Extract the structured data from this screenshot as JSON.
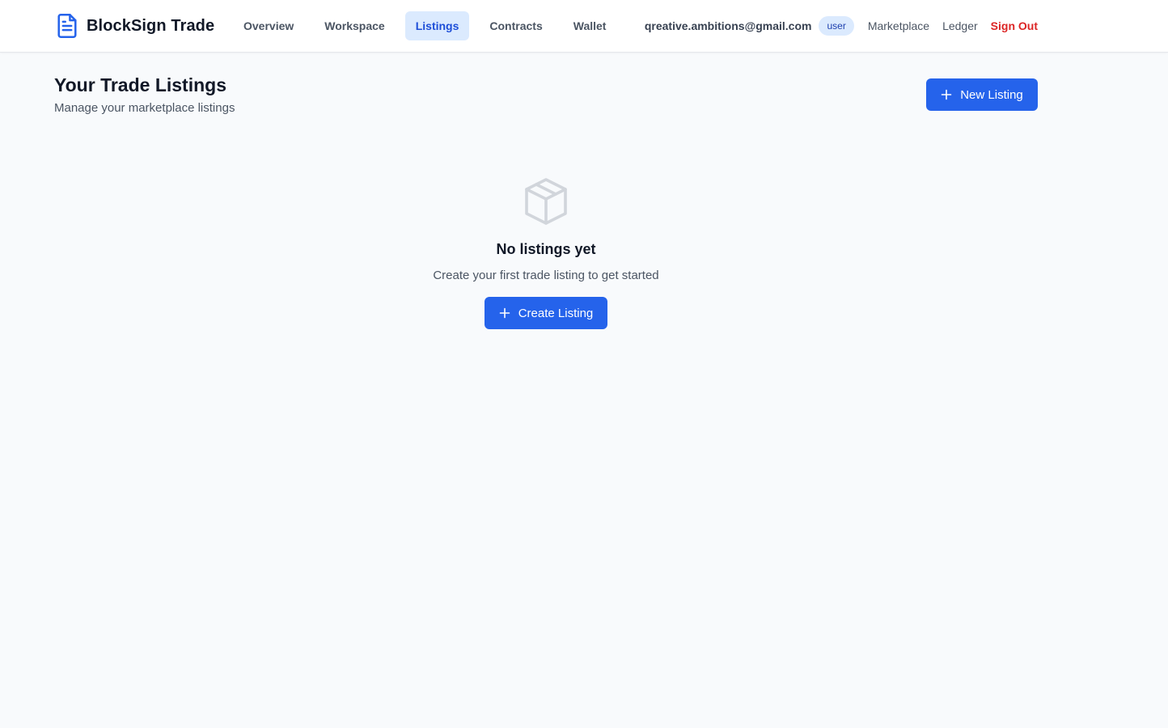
{
  "brand": {
    "name": "BlockSign Trade",
    "icon": "document-icon",
    "color": "#2563eb"
  },
  "nav": {
    "items": [
      {
        "label": "Overview",
        "active": false
      },
      {
        "label": "Workspace",
        "active": false
      },
      {
        "label": "Listings",
        "active": true
      },
      {
        "label": "Contracts",
        "active": false
      },
      {
        "label": "Wallet",
        "active": false
      }
    ]
  },
  "user": {
    "email": "qreative.ambitions@gmail.com",
    "role": "user",
    "links": {
      "marketplace": "Marketplace",
      "ledger": "Ledger",
      "sign_out": "Sign Out"
    }
  },
  "header": {
    "title": "Your Trade Listings",
    "subtitle": "Manage your marketplace listings",
    "new_listing_label": "New Listing"
  },
  "empty_state": {
    "icon": "package-icon",
    "title": "No listings yet",
    "message": "Create your first trade listing to get started",
    "cta_label": "Create Listing"
  },
  "colors": {
    "accent": "#2563eb",
    "accent_light": "#dbeafe",
    "danger": "#dc2626",
    "background": "#f8fafc"
  }
}
